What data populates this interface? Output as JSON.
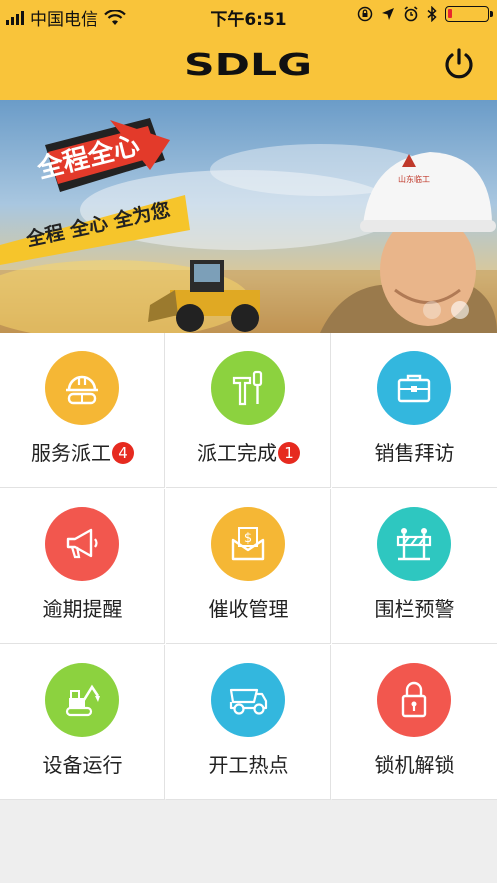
{
  "status_bar": {
    "carrier": "中国电信",
    "time": "下午6:51",
    "battery_level": 0.12,
    "icons": [
      "signal-icon",
      "wifi-icon",
      "rotation-lock-icon",
      "location-icon",
      "alarm-icon",
      "bluetooth-icon",
      "battery-icon"
    ]
  },
  "header": {
    "logo_text": "SDLG",
    "power_icon": "power-icon",
    "background": "#f9c43a"
  },
  "banner": {
    "badge_text": "全程全心",
    "slogan": "全程  全心  全为您",
    "helmet_text": "山东临工",
    "page_count": 2,
    "active_page": 2
  },
  "menu": [
    {
      "label": "服务派工",
      "icon": "helmet-goggles-icon",
      "color": "#f5b735",
      "badge": "4"
    },
    {
      "label": "派工完成",
      "icon": "hammer-screwdriver-icon",
      "color": "#8cd23f",
      "badge": "1"
    },
    {
      "label": "销售拜访",
      "icon": "briefcase-icon",
      "color": "#33b7de",
      "badge": ""
    },
    {
      "label": "逾期提醒",
      "icon": "megaphone-icon",
      "color": "#f2574e",
      "badge": ""
    },
    {
      "label": "催收管理",
      "icon": "money-envelope-icon",
      "color": "#f5b735",
      "badge": ""
    },
    {
      "label": "围栏预警",
      "icon": "barrier-icon",
      "color": "#2ec7c0",
      "badge": ""
    },
    {
      "label": "设备运行",
      "icon": "excavator-icon",
      "color": "#8cd23f",
      "badge": ""
    },
    {
      "label": "开工热点",
      "icon": "dump-truck-icon",
      "color": "#33b7de",
      "badge": ""
    },
    {
      "label": "锁机解锁",
      "icon": "padlock-icon",
      "color": "#f2574e",
      "badge": ""
    }
  ]
}
